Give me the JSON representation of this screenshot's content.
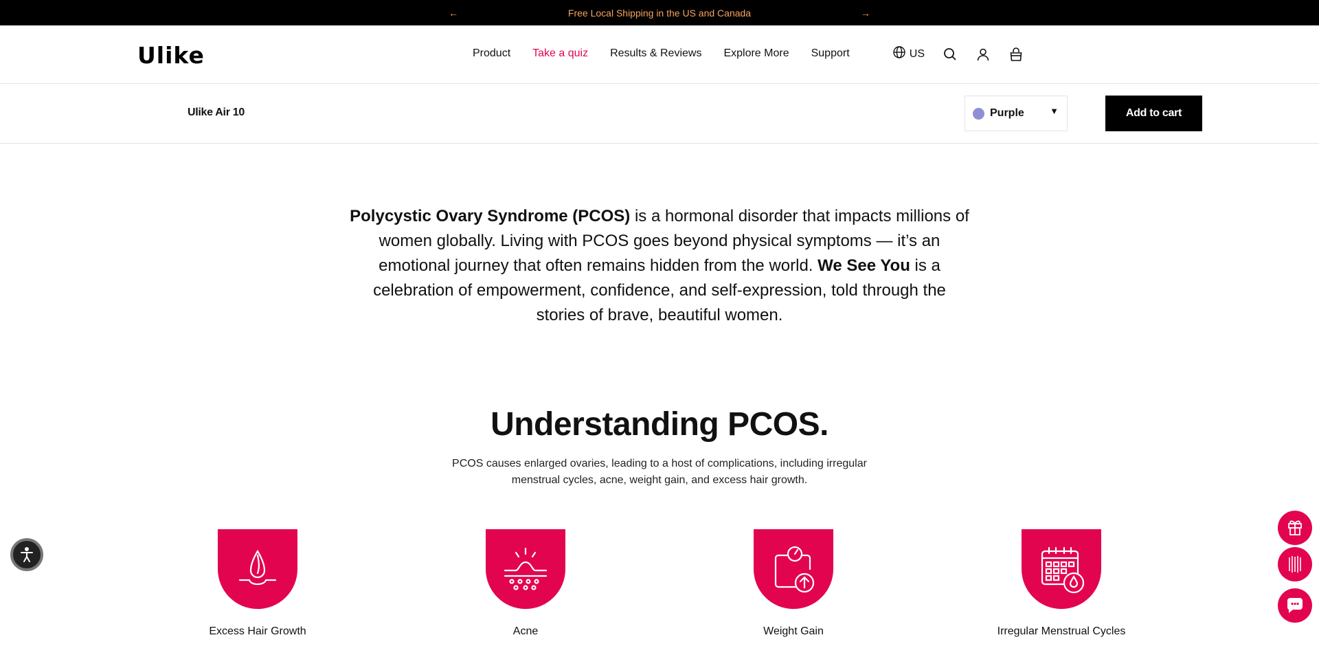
{
  "announcement": {
    "text": "Free Local Shipping in the US and Canada",
    "prev_icon": "arrow-left-icon",
    "next_icon": "arrow-right-icon"
  },
  "header": {
    "logo": "Ulike",
    "nav": [
      {
        "label": "Product",
        "active": false
      },
      {
        "label": "Take a quiz",
        "active": true
      },
      {
        "label": "Results & Reviews",
        "active": false
      },
      {
        "label": "Explore More",
        "active": false
      },
      {
        "label": "Support",
        "active": false
      }
    ],
    "region": "US",
    "icons": [
      "globe-icon",
      "search-icon",
      "account-icon",
      "cart-icon"
    ]
  },
  "product_bar": {
    "name": "Ulike Air 10",
    "variant": "Purple",
    "variant_color": "#8f8fd3",
    "cta": "Add to cart"
  },
  "intro": {
    "bold1": "Polycystic Ovary Syndrome (PCOS)",
    "text1": " is a hormonal disorder that impacts millions of women globally. Living with PCOS goes beyond physical symptoms — it’s an emotional journey that often remains hidden from the world. ",
    "bold2": "We See You",
    "text2": " is a celebration of empowerment, confidence, and self-expression, told through the stories of brave, beautiful women."
  },
  "understanding": {
    "title": "Understanding PCOS.",
    "subtitle": "PCOS causes enlarged ovaries, leading to a host of complications, including irregular menstrual cycles, acne, weight gain, and excess hair growth.",
    "symptoms": [
      {
        "label": "Excess Hair Growth",
        "icon": "hair-follicle-icon"
      },
      {
        "label": "Acne",
        "icon": "acne-skin-icon"
      },
      {
        "label": "Weight Gain",
        "icon": "scale-up-icon"
      },
      {
        "label": "Irregular Menstrual Cycles",
        "icon": "calendar-drop-icon"
      }
    ]
  },
  "colors": {
    "accent": "#e3044f",
    "announcement_text": "#f5a35c",
    "announcement_bg": "#000000"
  },
  "floating": [
    "accessibility-icon",
    "gift-icon",
    "device-icon",
    "chat-icon"
  ]
}
